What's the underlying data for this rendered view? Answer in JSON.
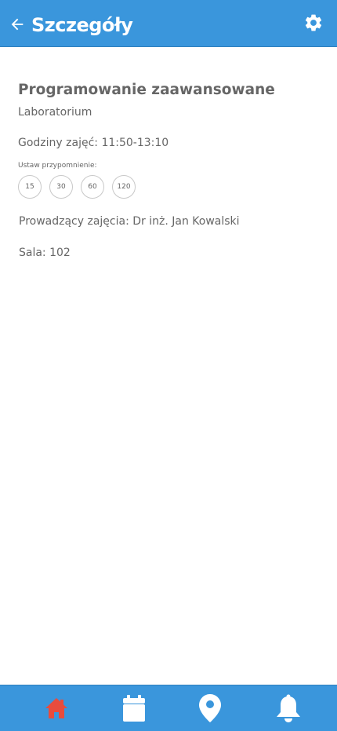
{
  "header": {
    "title": "Szczegóły",
    "back_icon": "arrow-left-icon",
    "settings_icon": "gear-icon"
  },
  "course": {
    "name": "Programowanie zaawansowane",
    "type": "Laboratorium",
    "hours": "Godziny zajęć: 11:50-13:10",
    "reminder_label": "Ustaw przypomnienie:",
    "reminders": [
      "15",
      "30",
      "60",
      "120"
    ],
    "teacher": "Prowadzący zajęcia: Dr inż. Jan Kowalski",
    "room": "Sala: 102"
  },
  "bottom_nav": {
    "items": [
      {
        "icon": "home-icon",
        "active": true
      },
      {
        "icon": "calendar-icon",
        "active": false
      },
      {
        "icon": "map-pin-icon",
        "active": false
      },
      {
        "icon": "bell-icon",
        "active": false
      }
    ]
  },
  "colors": {
    "primary": "#3a96dc",
    "active_icon": "#e84c3d",
    "icon": "#ffffff",
    "text": "#666666"
  }
}
